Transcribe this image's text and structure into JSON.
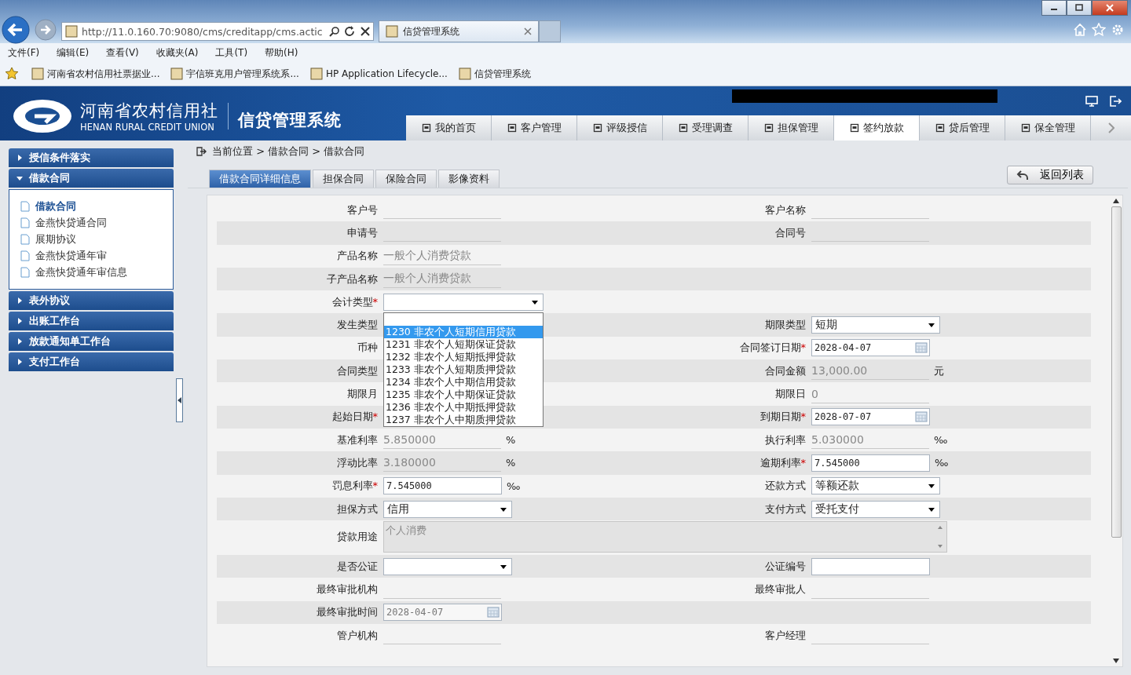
{
  "browser": {
    "url": "http://11.0.160.70:9080/cms/creditapp/cms.actic",
    "tab_title": "信贷管理系统",
    "menu": [
      "文件(F)",
      "编辑(E)",
      "查看(V)",
      "收藏夹(A)",
      "工具(T)",
      "帮助(H)"
    ],
    "favorites": [
      "河南省农村信用社票据业...",
      "宇信班克用户管理系统系...",
      "HP Application Lifecycle...",
      "信贷管理系统"
    ]
  },
  "header": {
    "logo_cn": "河南省农村信用社",
    "logo_en": "HENAN RURAL CREDIT UNION",
    "system_name": "信贷管理系统",
    "nav": [
      {
        "label": "我的首页",
        "selected": false
      },
      {
        "label": "客户管理",
        "selected": false
      },
      {
        "label": "评级授信",
        "selected": false
      },
      {
        "label": "受理调查",
        "selected": false
      },
      {
        "label": "担保管理",
        "selected": false
      },
      {
        "label": "签约放款",
        "selected": true
      },
      {
        "label": "贷后管理",
        "selected": false
      },
      {
        "label": "保全管理",
        "selected": false
      }
    ]
  },
  "sidebar": {
    "groups": [
      {
        "label": "授信条件落实",
        "expanded": false
      },
      {
        "label": "借款合同",
        "expanded": true,
        "items": [
          {
            "label": "借款合同",
            "selected": true
          },
          {
            "label": "金燕快贷通合同",
            "selected": false
          },
          {
            "label": "展期协议",
            "selected": false
          },
          {
            "label": "金燕快贷通年审",
            "selected": false
          },
          {
            "label": "金燕快贷通年审信息",
            "selected": false
          }
        ]
      },
      {
        "label": "表外协议",
        "expanded": false
      },
      {
        "label": "出账工作台",
        "expanded": false
      },
      {
        "label": "放款通知单工作台",
        "expanded": false
      },
      {
        "label": "支付工作台",
        "expanded": false
      }
    ]
  },
  "breadcrumb": "当前位置 > 借款合同 > 借款合同",
  "tabs": [
    {
      "label": "借款合同详细信息",
      "selected": true
    },
    {
      "label": "担保合同",
      "selected": false
    },
    {
      "label": "保险合同",
      "selected": false
    },
    {
      "label": "影像资料",
      "selected": false
    }
  ],
  "back_button": "返回列表",
  "form": {
    "rows": [
      {
        "left": {
          "label": "客户号",
          "kind": "text"
        },
        "right": {
          "label": "客户名称",
          "kind": "text"
        }
      },
      {
        "left": {
          "label": "申请号",
          "kind": "text"
        },
        "right": {
          "label": "合同号",
          "kind": "text"
        }
      },
      {
        "left": {
          "label": "产品名称",
          "kind": "text",
          "value": "一般个人消费贷款"
        }
      },
      {
        "left": {
          "label": "子产品名称",
          "kind": "text",
          "value": "一般个人消费贷款"
        }
      },
      {
        "left": {
          "label": "会计类型",
          "required_mark": "*",
          "kind": "select",
          "open": true,
          "options": [
            {
              "label": "1230 非农个人短期信用贷款",
              "selected": true
            },
            {
              "label": "1231 非农个人短期保证贷款",
              "selected": false
            },
            {
              "label": "1232 非农个人短期抵押贷款",
              "selected": false
            },
            {
              "label": "1233 非农个人短期质押贷款",
              "selected": false
            },
            {
              "label": "1234 非农个人中期信用贷款",
              "selected": false
            },
            {
              "label": "1235 非农个人中期保证贷款",
              "selected": false
            },
            {
              "label": "1236 非农个人中期抵押贷款",
              "selected": false
            },
            {
              "label": "1237 非农个人中期质押贷款",
              "selected": false
            }
          ]
        }
      },
      {
        "left": {
          "label": "发生类型"
        },
        "right": {
          "label": "期限类型",
          "kind": "select",
          "open": false,
          "value": "短期"
        }
      },
      {
        "left": {
          "label": "币种"
        },
        "right": {
          "label": "合同签订日期",
          "required_mark": "*",
          "kind": "date",
          "value": "2028-04-07"
        }
      },
      {
        "left": {
          "label": "合同类型"
        },
        "right": {
          "label": "合同金额",
          "kind": "text",
          "value": "13,000.00",
          "unit": "元"
        }
      },
      {
        "left": {
          "label": "期限月"
        },
        "right": {
          "label": "期限日",
          "kind": "text",
          "value": "0"
        }
      },
      {
        "left": {
          "label": "起始日期",
          "required_mark": "*"
        },
        "right": {
          "label": "到期日期",
          "required_mark": "*",
          "kind": "date",
          "value": "2028-07-07"
        }
      },
      {
        "left": {
          "label": "基准利率",
          "kind": "text",
          "value": "5.850000",
          "unit": "%"
        },
        "right": {
          "label": "执行利率",
          "kind": "text",
          "value": "5.030000",
          "unit": "‰"
        }
      },
      {
        "left": {
          "label": "浮动比率",
          "kind": "text",
          "value": "3.180000",
          "unit": "%"
        },
        "right": {
          "label": "逾期利率",
          "required_mark": "*",
          "kind": "input",
          "value": "7.545000",
          "unit": "‰"
        }
      },
      {
        "left": {
          "label": "罚息利率",
          "required_mark": "*",
          "kind": "input",
          "value": "7.545000",
          "unit": "‰"
        },
        "right": {
          "label": "还款方式",
          "kind": "select",
          "open": false,
          "value": "等额还款"
        }
      },
      {
        "left": {
          "label": "担保方式",
          "kind": "select",
          "open": false,
          "value": "信用"
        },
        "right": {
          "label": "支付方式",
          "kind": "select",
          "open": false,
          "value": "受托支付"
        }
      },
      {
        "left": {
          "label": "贷款用途",
          "kind": "textarea",
          "value": "个人消费"
        }
      },
      {
        "left": {
          "label": "是否公证",
          "kind": "select",
          "open": false
        },
        "right": {
          "label": "公证编号",
          "kind": "input"
        }
      },
      {
        "left": {
          "label": "最终审批机构",
          "kind": "text"
        },
        "right": {
          "label": "最终审批人",
          "kind": "text"
        }
      },
      {
        "left": {
          "label": "最终审批时间",
          "kind": "date",
          "value": "2028-04-07",
          "disabled": true
        }
      },
      {
        "left": {
          "label": "管户机构",
          "kind": "text"
        },
        "right": {
          "label": "客户经理",
          "kind": "text"
        }
      }
    ]
  }
}
